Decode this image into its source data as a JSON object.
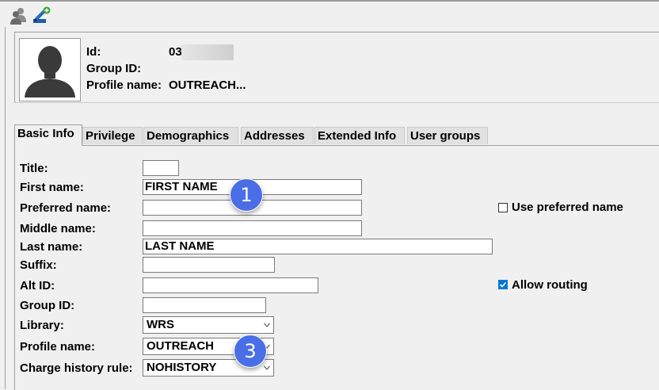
{
  "header": {
    "id_label": "Id:",
    "id_value": "03",
    "group_id_label": "Group ID:",
    "group_id_value": "",
    "profile_label": "Profile name:",
    "profile_value": "OUTREACH..."
  },
  "toolbar": {
    "icons": [
      "users-icon",
      "edit-user-icon"
    ]
  },
  "tabs": [
    "Basic Info",
    "Privilege",
    "Demographics",
    "Addresses",
    "Extended Info",
    "User groups"
  ],
  "form": {
    "title_label": "Title:",
    "title_value": "",
    "first_name_label": "First name:",
    "first_name_value": "FIRST NAME",
    "preferred_name_label": "Preferred name:",
    "preferred_name_value": "",
    "middle_name_label": "Middle name:",
    "middle_name_value": "",
    "last_name_label": "Last name:",
    "last_name_value": "LAST NAME",
    "suffix_label": "Suffix:",
    "suffix_value": "",
    "alt_id_label": "Alt ID:",
    "alt_id_value": "",
    "group_id_label": "Group ID:",
    "group_id_value": "",
    "library_label": "Library:",
    "library_value": "WRS",
    "profile_label": "Profile name:",
    "profile_value": "OUTREACH",
    "charge_label": "Charge history rule:",
    "charge_value": "NOHISTORY",
    "use_preferred_label": "Use preferred name",
    "use_preferred_checked": false,
    "allow_routing_label": "Allow routing",
    "allow_routing_checked": true
  },
  "callouts": [
    "1",
    "3"
  ],
  "colors": {
    "callout": "#4a6ee6",
    "checkbox": "#0078d7"
  }
}
